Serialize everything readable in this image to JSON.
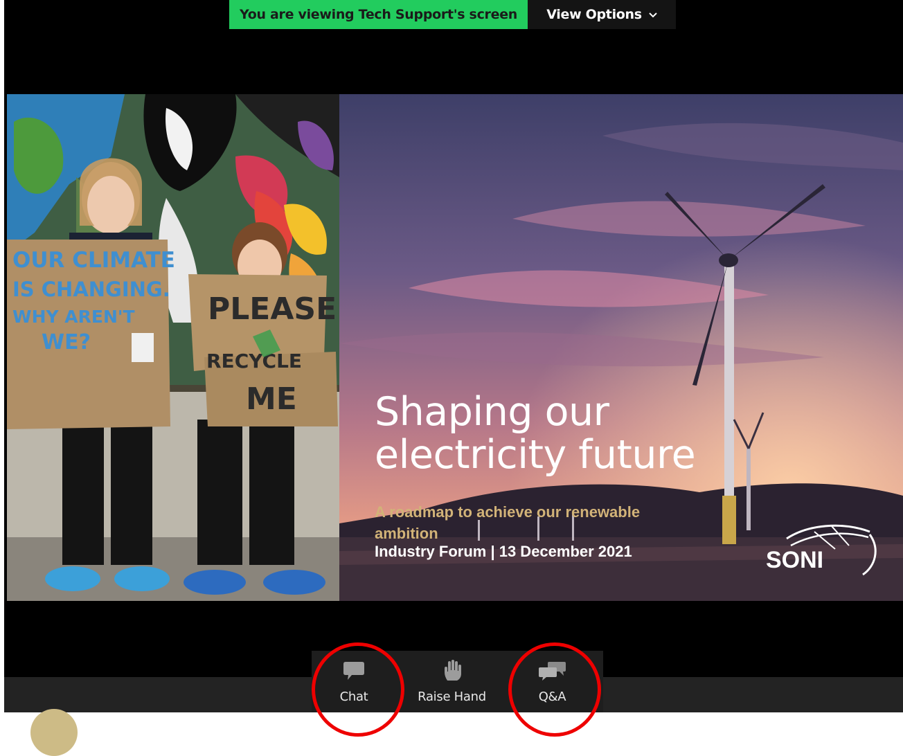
{
  "banner": {
    "viewing_text": "You are viewing Tech Support's screen",
    "view_options_label": "View Options",
    "chevron_icon": "chevron-down-icon"
  },
  "slide": {
    "title": "Shaping our electricity future",
    "subtitle": "A roadmap to achieve our renewable ambition",
    "event": "Industry Forum | 13 December 2021",
    "logo_text": "SONI",
    "sign_1": "OUR CLIMATE IS CHANGING. WHY AREN'T WE?",
    "sign_2": "PLEASE RECYCLE ME"
  },
  "toolbar": {
    "chat_label": "Chat",
    "chat_icon": "chat-bubble-icon",
    "raise_hand_label": "Raise Hand",
    "raise_hand_icon": "hand-icon",
    "qa_label": "Q&A",
    "qa_icon": "qa-bubbles-icon"
  },
  "colors": {
    "banner_green": "#22cc5e",
    "annotation_red": "#ee0000",
    "subtitle_gold": "#d2b378"
  }
}
